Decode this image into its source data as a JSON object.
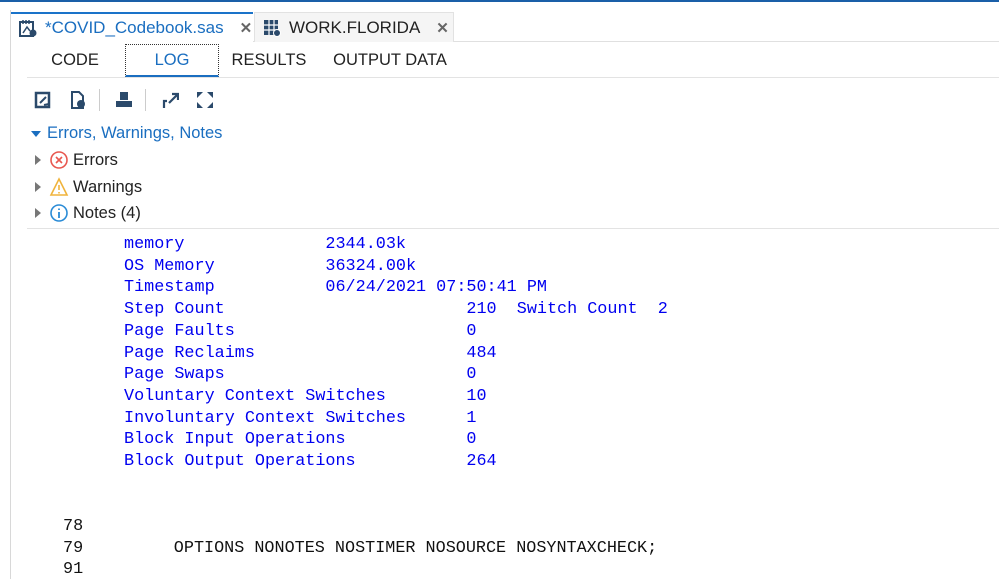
{
  "tabs": [
    {
      "label": "*COVID_Codebook.sas",
      "icon": "sas-program-icon",
      "active": true
    },
    {
      "label": "WORK.FLORIDA",
      "icon": "table-icon",
      "active": false
    }
  ],
  "subtabs": [
    "CODE",
    "LOG",
    "RESULTS",
    "OUTPUT DATA"
  ],
  "selected_subtab": "LOG",
  "toolbar": [
    "save-log-icon",
    "download-log-icon",
    "print-icon",
    "popout-icon",
    "maximize-icon"
  ],
  "ewn": {
    "title": "Errors, Warnings, Notes",
    "items": [
      {
        "label": "Errors",
        "icon": "error-icon"
      },
      {
        "label": "Warnings",
        "icon": "warning-icon"
      },
      {
        "label": "Notes (4)",
        "icon": "info-icon"
      }
    ]
  },
  "colors": {
    "accent": "#1a6ec0",
    "log_note": "#0000f0"
  },
  "log_lines": [
    "memory              2344.03k",
    "OS Memory           36324.00k",
    "Timestamp           06/24/2021 07:50:41 PM",
    "Step Count                        210  Switch Count  2",
    "Page Faults                       0",
    "Page Reclaims                     484",
    "Page Swaps                        0",
    "Voluntary Context Switches        10",
    "Involuntary Context Switches      1",
    "Block Input Operations            0",
    "Block Output Operations           264"
  ],
  "code_lines": [
    {
      "num": "78",
      "text": ""
    },
    {
      "num": "79",
      "text": "OPTIONS NONOTES NOSTIMER NOSOURCE NOSYNTAXCHECK;"
    },
    {
      "num": "91",
      "text": ""
    }
  ]
}
